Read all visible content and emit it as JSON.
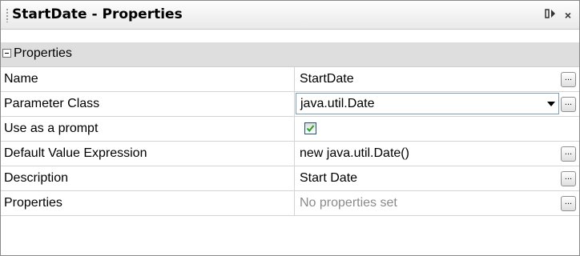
{
  "panel": {
    "title": "StartDate - Properties",
    "pin_glyph": "▯▸",
    "close_glyph": "×"
  },
  "category": {
    "label": "Properties",
    "expanded": true
  },
  "rows": [
    {
      "name": "Name",
      "value": "StartDate",
      "editor": "text-with-ellipsis"
    },
    {
      "name": "Parameter Class",
      "value": "java.util.Date",
      "editor": "dropdown-with-ellipsis"
    },
    {
      "name": "Use as a prompt",
      "value": "",
      "editor": "checkbox",
      "checked": true
    },
    {
      "name": "Default Value Expression",
      "value": "new java.util.Date()",
      "editor": "text-with-ellipsis"
    },
    {
      "name": "Description",
      "value": "Start Date",
      "editor": "text-with-ellipsis"
    },
    {
      "name": "Properties",
      "value": "No properties set",
      "editor": "text-with-ellipsis"
    }
  ],
  "ellipsis_label": "...",
  "colors": {
    "category_bg": "#dedede",
    "grid_line": "#d4d4d4",
    "placeholder_text": "#8a8a8a",
    "checkbox_border": "#1c5180"
  }
}
